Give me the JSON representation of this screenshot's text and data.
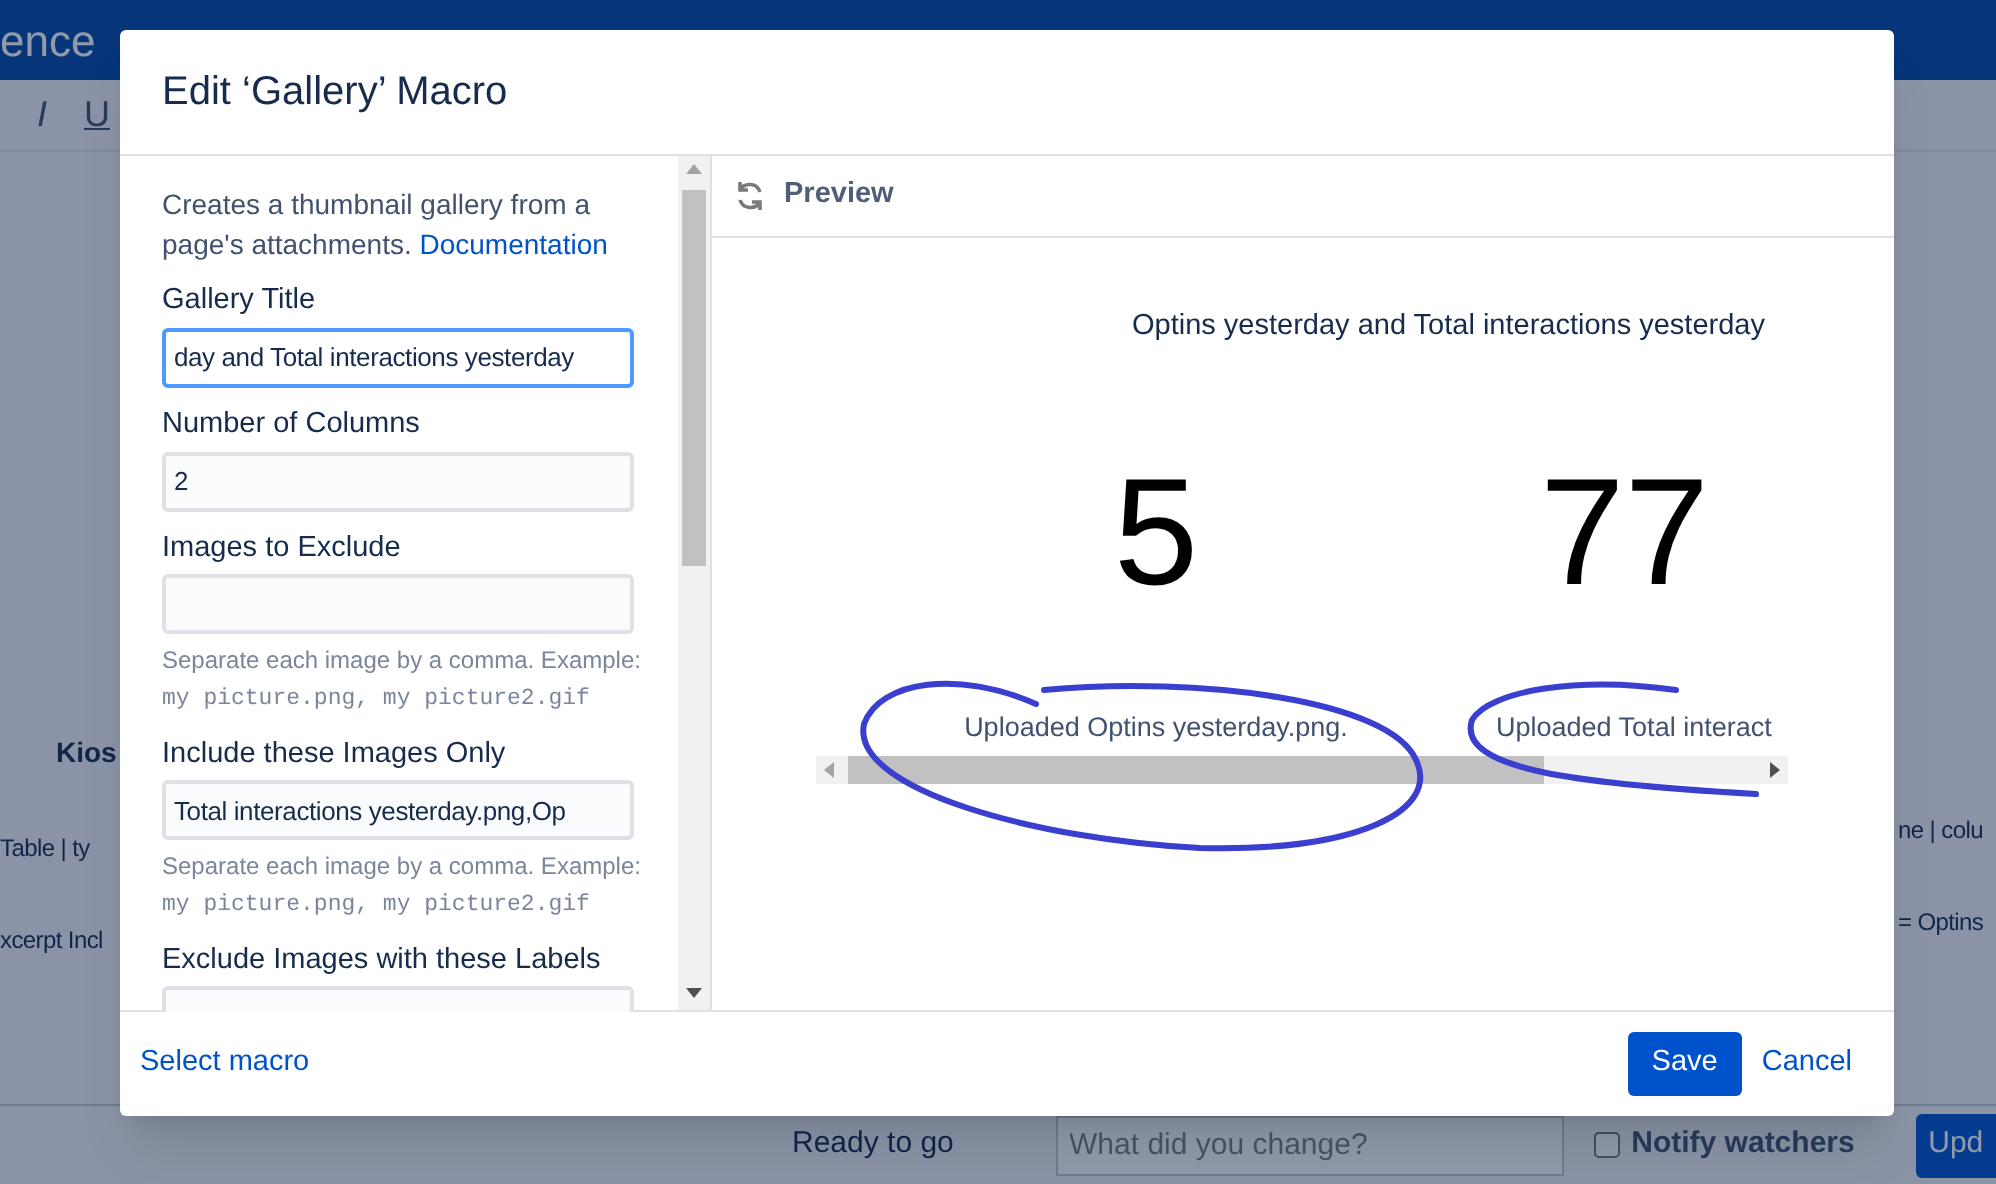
{
  "background": {
    "brand": "ence",
    "toolbar": [
      {
        "label": "I",
        "kind": "italic"
      },
      {
        "label": "U",
        "kind": "underline"
      }
    ],
    "left_texts": [
      {
        "text": "Kios",
        "kind": "heading"
      },
      {
        "text": "Table  | ty",
        "kind": "plain"
      },
      {
        "text": "xcerpt Incl",
        "kind": "plain"
      }
    ],
    "right_texts": [
      {
        "text": "ne | colu"
      },
      {
        "text": "= Optins"
      }
    ],
    "status": "Ready to go",
    "comment_placeholder": "What did you change?",
    "notify": {
      "label": "Notify watchers",
      "checked": false
    },
    "update_button": "Upd"
  },
  "dialog": {
    "title": "Edit ‘Gallery’ Macro",
    "description": "Creates a thumbnail gallery from a page's attachments.",
    "doc_link": "Documentation",
    "fields": [
      {
        "label": "Gallery Title",
        "value": "day and Total interactions yesterday",
        "focused": true
      },
      {
        "label": "Number of Columns",
        "value": "2",
        "focused": false
      },
      {
        "label": "Images to Exclude",
        "focused": false,
        "help": "Separate each image by a comma. Example:",
        "example": "my picture.png, my picture2.gif"
      },
      {
        "label": "Include these Images Only",
        "value": "Total interactions yesterday.png,Op",
        "focused": false,
        "help": "Separate each image by a comma. Example:",
        "example": "my picture.png, my picture2.gif"
      },
      {
        "label": "Exclude Images with these Labels",
        "focused": false
      }
    ],
    "preview": {
      "label": "Preview",
      "gallery_title": "Optins yesterday and Total interactions yesterday",
      "images": [
        {
          "figure": "5",
          "caption": "Uploaded Optins yesterday.png."
        },
        {
          "figure": "77",
          "caption": "Uploaded Total interact"
        }
      ]
    },
    "footer": {
      "link": "Select macro",
      "save": "Save",
      "cancel": "Cancel"
    }
  }
}
